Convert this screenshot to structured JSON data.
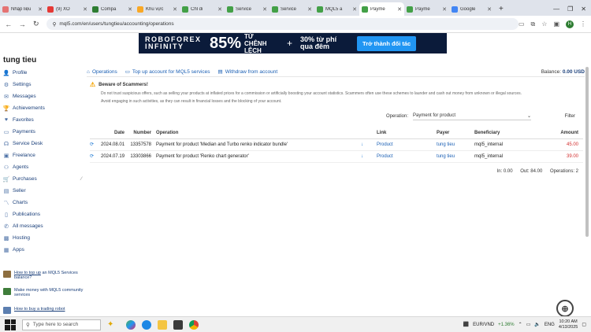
{
  "browser": {
    "tabs": [
      {
        "title": "Nhập liệu",
        "color": "#e57373",
        "active": false
      },
      {
        "title": "(9) XO",
        "color": "#e53935",
        "active": false
      },
      {
        "title": "Compa",
        "color": "#2e7d32",
        "active": false
      },
      {
        "title": "Khu vực",
        "color": "#f9a825",
        "active": false
      },
      {
        "title": "Chỉ đi",
        "color": "#43a047",
        "active": false
      },
      {
        "title": "Service",
        "color": "#43a047",
        "active": false
      },
      {
        "title": "Service",
        "color": "#43a047",
        "active": false
      },
      {
        "title": "MQL5 a",
        "color": "#43a047",
        "active": false
      },
      {
        "title": "Payme",
        "color": "#43a047",
        "active": true
      },
      {
        "title": "Payme",
        "color": "#43a047",
        "active": false
      },
      {
        "title": "Google",
        "color": "#4285f4",
        "active": false
      }
    ],
    "url": "mql5.com/en/users/tungtieu/accounting/operations",
    "profile_initial": "H"
  },
  "banner": {
    "brand": "ROBOFOREX INFINITY",
    "pct": "85%",
    "tu_chenh": "TỪ CHÊNH LỆCH",
    "plus": "+",
    "bonus": "30% từ phí qua đêm",
    "cta": "Trở thành đối tác"
  },
  "username": "tung tieu",
  "sidebar": [
    {
      "label": "Profile",
      "icon": "user-icon",
      "glyph": "👤",
      "arrow": ""
    },
    {
      "label": "Settings",
      "icon": "gear-icon",
      "glyph": "⚙",
      "arrow": ""
    },
    {
      "label": "Messages",
      "icon": "message-icon",
      "glyph": "✉",
      "arrow": ""
    },
    {
      "label": "Achievements",
      "icon": "trophy-icon",
      "glyph": "🏆",
      "arrow": ""
    },
    {
      "label": "Favorites",
      "icon": "heart-icon",
      "glyph": "♥",
      "arrow": ""
    },
    {
      "label": "Payments",
      "icon": "wallet-icon",
      "glyph": "▭",
      "arrow": ""
    },
    {
      "label": "Service Desk",
      "icon": "headset-icon",
      "glyph": "☊",
      "arrow": ""
    },
    {
      "label": "Freelance",
      "icon": "briefcase-icon",
      "glyph": "▣",
      "arrow": ""
    },
    {
      "label": "Agents",
      "icon": "robot-icon",
      "glyph": "⚇",
      "arrow": ""
    },
    {
      "label": "Purchases",
      "icon": "cart-icon",
      "glyph": "🛒",
      "arrow": "⁄"
    },
    {
      "label": "Seller",
      "icon": "tag-icon",
      "glyph": "▤",
      "arrow": ""
    },
    {
      "label": "Charts",
      "icon": "chart-icon",
      "glyph": "〽",
      "arrow": ""
    },
    {
      "label": "Publications",
      "icon": "document-icon",
      "glyph": "▯",
      "arrow": ""
    },
    {
      "label": "All messages",
      "icon": "chat-icon",
      "glyph": "✆",
      "arrow": ""
    },
    {
      "label": "Hosting",
      "icon": "server-icon",
      "glyph": "▩",
      "arrow": ""
    },
    {
      "label": "Apps",
      "icon": "apps-icon",
      "glyph": "▦",
      "arrow": ""
    }
  ],
  "promos": [
    {
      "link": "How to top up",
      "text": " an MQL5 Services balance?"
    },
    {
      "link": "",
      "text": "Make money with MQL5 community services"
    },
    {
      "link": "How to buy a trading robot",
      "text": ""
    }
  ],
  "topnav": {
    "operations": "Operations",
    "topup": "Top up account for MQL5 services",
    "withdraw": "Withdraw from account",
    "balance_label": "Balance:",
    "balance_value": "0.00 USD"
  },
  "warning": {
    "title": "Beware of Scammers!",
    "text1": "Do not trust suspicious offers, such as selling your products at inflated prices for a commission or artificially boosting your account statistics. Scammers often use these schemes to launder and cash out money from unknown or illegal sources.",
    "text2": "Avoid engaging in such activities, as they can result in financial losses and the blocking of your account."
  },
  "filter": {
    "label": "Operation:",
    "selected": "Payment for product",
    "button": "Filter"
  },
  "table": {
    "headers": {
      "date": "Date",
      "number": "Number",
      "operation": "Operation",
      "link": "Link",
      "payer": "Payer",
      "beneficiary": "Beneficiary",
      "amount": "Amount"
    },
    "rows": [
      {
        "date": "2024.08.01",
        "number": "13357578",
        "operation": "Payment for product 'Median and Turbo renko indicator bundle'",
        "link": "Product",
        "payer": "tung tieu",
        "beneficiary": "mql5_internal",
        "amount": "45.00"
      },
      {
        "date": "2024.07.19",
        "number": "13303866",
        "operation": "Payment for product 'Renko chart generator'",
        "link": "Product",
        "payer": "tung tieu",
        "beneficiary": "mql5_internal",
        "amount": "39.00"
      }
    ]
  },
  "summary": {
    "in": "In: 0.00",
    "out": "Out: 84.00",
    "ops": "Operations: 2"
  },
  "taskbar": {
    "search_placeholder": "Type here to search",
    "ticker": "EUR/VND",
    "ticker_change": "+1.36%",
    "lang": "ENG",
    "time": "10:20 AM",
    "date": "4/13/2025"
  }
}
